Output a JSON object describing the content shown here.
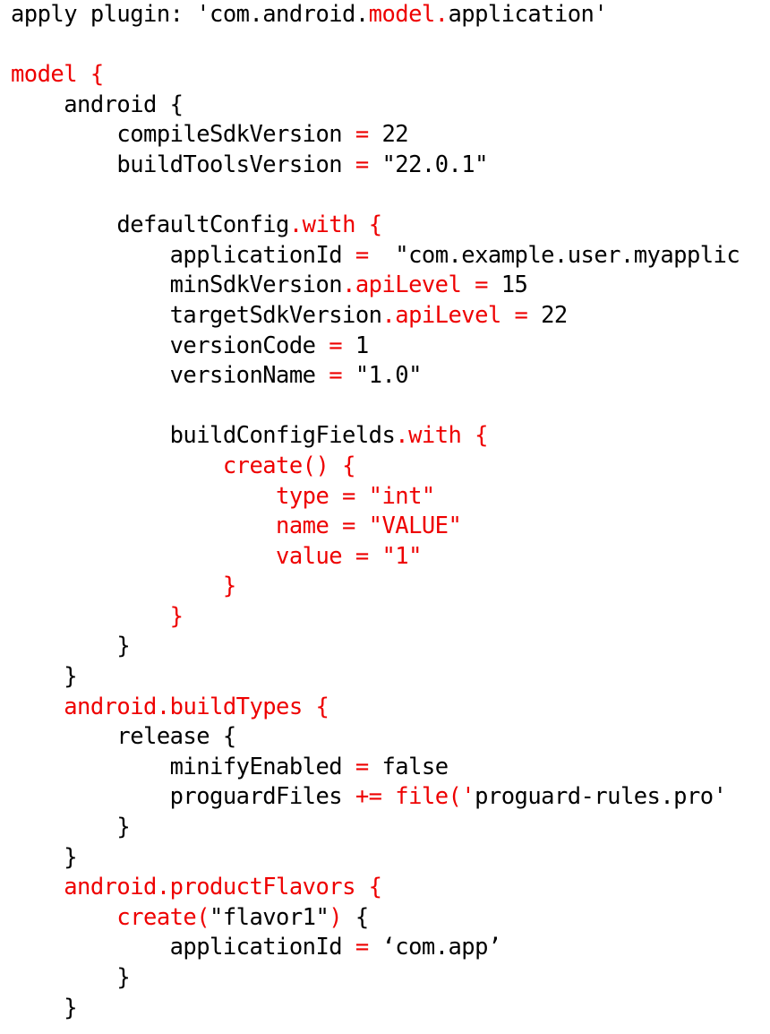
{
  "document": {
    "kind": "source-code-listing",
    "language": "gradle",
    "filename_hint": "build.gradle",
    "background_color": "#ffffff",
    "colors": {
      "plain": "#000000",
      "keyword": "#ee0000"
    },
    "indent_unit": "    ",
    "clipped_right_edge": true
  },
  "lines": [
    {
      "number": 1,
      "text": "apply plugin: 'com.android.model.application'",
      "tokens": [
        {
          "t": "apply plugin: 'com.android.",
          "c": "plain"
        },
        {
          "t": "model.",
          "c": "keyword"
        },
        {
          "t": "application'",
          "c": "plain"
        }
      ]
    },
    {
      "number": 2,
      "text": "",
      "tokens": []
    },
    {
      "number": 3,
      "text": "model {",
      "tokens": [
        {
          "t": "model {",
          "c": "keyword"
        }
      ]
    },
    {
      "number": 4,
      "text": "    android {",
      "tokens": [
        {
          "t": "    android {",
          "c": "plain"
        }
      ]
    },
    {
      "number": 5,
      "text": "        compileSdkVersion = 22",
      "tokens": [
        {
          "t": "        compileSdkVersion ",
          "c": "plain"
        },
        {
          "t": "=",
          "c": "keyword"
        },
        {
          "t": " 22",
          "c": "plain"
        }
      ]
    },
    {
      "number": 6,
      "text": "        buildToolsVersion = \"22.0.1\"",
      "tokens": [
        {
          "t": "        buildToolsVersion ",
          "c": "plain"
        },
        {
          "t": "=",
          "c": "keyword"
        },
        {
          "t": " \"22.0.1\"",
          "c": "plain"
        }
      ]
    },
    {
      "number": 7,
      "text": "",
      "tokens": []
    },
    {
      "number": 8,
      "text": "        defaultConfig.with {",
      "tokens": [
        {
          "t": "        defaultConfig",
          "c": "plain"
        },
        {
          "t": ".with",
          "c": "keyword"
        },
        {
          "t": " ",
          "c": "plain"
        },
        {
          "t": "{",
          "c": "keyword"
        }
      ]
    },
    {
      "number": 9,
      "text": "            applicationId =  \"com.example.user.myapplic",
      "tokens": [
        {
          "t": "            applicationId ",
          "c": "plain"
        },
        {
          "t": "=",
          "c": "keyword"
        },
        {
          "t": "  \"com.example.user.myapplic",
          "c": "plain"
        }
      ]
    },
    {
      "number": 10,
      "text": "            minSdkVersion.apiLevel = 15",
      "tokens": [
        {
          "t": "            minSdkVersion",
          "c": "plain"
        },
        {
          "t": ".apiLevel",
          "c": "keyword"
        },
        {
          "t": " ",
          "c": "plain"
        },
        {
          "t": "=",
          "c": "keyword"
        },
        {
          "t": " 15",
          "c": "plain"
        }
      ]
    },
    {
      "number": 11,
      "text": "            targetSdkVersion.apiLevel = 22",
      "tokens": [
        {
          "t": "            targetSdkVersion",
          "c": "plain"
        },
        {
          "t": ".apiLevel",
          "c": "keyword"
        },
        {
          "t": " ",
          "c": "plain"
        },
        {
          "t": "=",
          "c": "keyword"
        },
        {
          "t": " 22",
          "c": "plain"
        }
      ]
    },
    {
      "number": 12,
      "text": "            versionCode = 1",
      "tokens": [
        {
          "t": "            versionCode ",
          "c": "plain"
        },
        {
          "t": "=",
          "c": "keyword"
        },
        {
          "t": " 1",
          "c": "plain"
        }
      ]
    },
    {
      "number": 13,
      "text": "            versionName = \"1.0\"",
      "tokens": [
        {
          "t": "            versionName ",
          "c": "plain"
        },
        {
          "t": "=",
          "c": "keyword"
        },
        {
          "t": " \"1.0\"",
          "c": "plain"
        }
      ]
    },
    {
      "number": 14,
      "text": "",
      "tokens": []
    },
    {
      "number": 15,
      "text": "            buildConfigFields.with {",
      "tokens": [
        {
          "t": "            buildConfigFields",
          "c": "plain"
        },
        {
          "t": ".with",
          "c": "keyword"
        },
        {
          "t": " ",
          "c": "plain"
        },
        {
          "t": "{",
          "c": "keyword"
        }
      ]
    },
    {
      "number": 16,
      "text": "                create() {",
      "tokens": [
        {
          "t": "                ",
          "c": "plain"
        },
        {
          "t": "create() {",
          "c": "keyword"
        }
      ]
    },
    {
      "number": 17,
      "text": "                    type = \"int\"",
      "tokens": [
        {
          "t": "                    ",
          "c": "plain"
        },
        {
          "t": "type = \"int\"",
          "c": "keyword"
        }
      ]
    },
    {
      "number": 18,
      "text": "                    name = \"VALUE\"",
      "tokens": [
        {
          "t": "                    ",
          "c": "plain"
        },
        {
          "t": "name = \"VALUE\"",
          "c": "keyword"
        }
      ]
    },
    {
      "number": 19,
      "text": "                    value = \"1\"",
      "tokens": [
        {
          "t": "                    ",
          "c": "plain"
        },
        {
          "t": "value = \"1\"",
          "c": "keyword"
        }
      ]
    },
    {
      "number": 20,
      "text": "                }",
      "tokens": [
        {
          "t": "                ",
          "c": "plain"
        },
        {
          "t": "}",
          "c": "keyword"
        }
      ]
    },
    {
      "number": 21,
      "text": "            }",
      "tokens": [
        {
          "t": "            ",
          "c": "plain"
        },
        {
          "t": "}",
          "c": "keyword"
        }
      ]
    },
    {
      "number": 22,
      "text": "        }",
      "tokens": [
        {
          "t": "        }",
          "c": "plain"
        }
      ]
    },
    {
      "number": 23,
      "text": "    }",
      "tokens": [
        {
          "t": "    }",
          "c": "plain"
        }
      ]
    },
    {
      "number": 24,
      "text": "    android.buildTypes {",
      "tokens": [
        {
          "t": "    ",
          "c": "plain"
        },
        {
          "t": "android.buildTypes {",
          "c": "keyword"
        }
      ]
    },
    {
      "number": 25,
      "text": "        release {",
      "tokens": [
        {
          "t": "        release {",
          "c": "plain"
        }
      ]
    },
    {
      "number": 26,
      "text": "            minifyEnabled = false",
      "tokens": [
        {
          "t": "            minifyEnabled ",
          "c": "plain"
        },
        {
          "t": "=",
          "c": "keyword"
        },
        {
          "t": " false",
          "c": "plain"
        }
      ]
    },
    {
      "number": 27,
      "text": "            proguardFiles += file('proguard-rules.pro'",
      "tokens": [
        {
          "t": "            proguardFiles ",
          "c": "plain"
        },
        {
          "t": "+=",
          "c": "keyword"
        },
        {
          "t": " ",
          "c": "plain"
        },
        {
          "t": "file('",
          "c": "keyword"
        },
        {
          "t": "proguard-rules.pro'",
          "c": "plain"
        }
      ]
    },
    {
      "number": 28,
      "text": "        }",
      "tokens": [
        {
          "t": "        }",
          "c": "plain"
        }
      ]
    },
    {
      "number": 29,
      "text": "    }",
      "tokens": [
        {
          "t": "    }",
          "c": "plain"
        }
      ]
    },
    {
      "number": 30,
      "text": "    android.productFlavors {",
      "tokens": [
        {
          "t": "    ",
          "c": "plain"
        },
        {
          "t": "android.productFlavors {",
          "c": "keyword"
        }
      ]
    },
    {
      "number": 31,
      "text": "        create(\"flavor1\") {",
      "tokens": [
        {
          "t": "        ",
          "c": "plain"
        },
        {
          "t": "create(",
          "c": "keyword"
        },
        {
          "t": "\"flavor1\"",
          "c": "plain"
        },
        {
          "t": ")",
          "c": "keyword"
        },
        {
          "t": " {",
          "c": "plain"
        }
      ]
    },
    {
      "number": 32,
      "text": "            applicationId = ‘com.app’",
      "tokens": [
        {
          "t": "            applicationId ",
          "c": "plain"
        },
        {
          "t": "=",
          "c": "keyword"
        },
        {
          "t": " ‘com.app’",
          "c": "plain"
        }
      ]
    },
    {
      "number": 33,
      "text": "        }",
      "tokens": [
        {
          "t": "        }",
          "c": "plain"
        }
      ]
    },
    {
      "number": 34,
      "text": "    }",
      "tokens": [
        {
          "t": "    }",
          "c": "plain"
        }
      ]
    }
  ]
}
